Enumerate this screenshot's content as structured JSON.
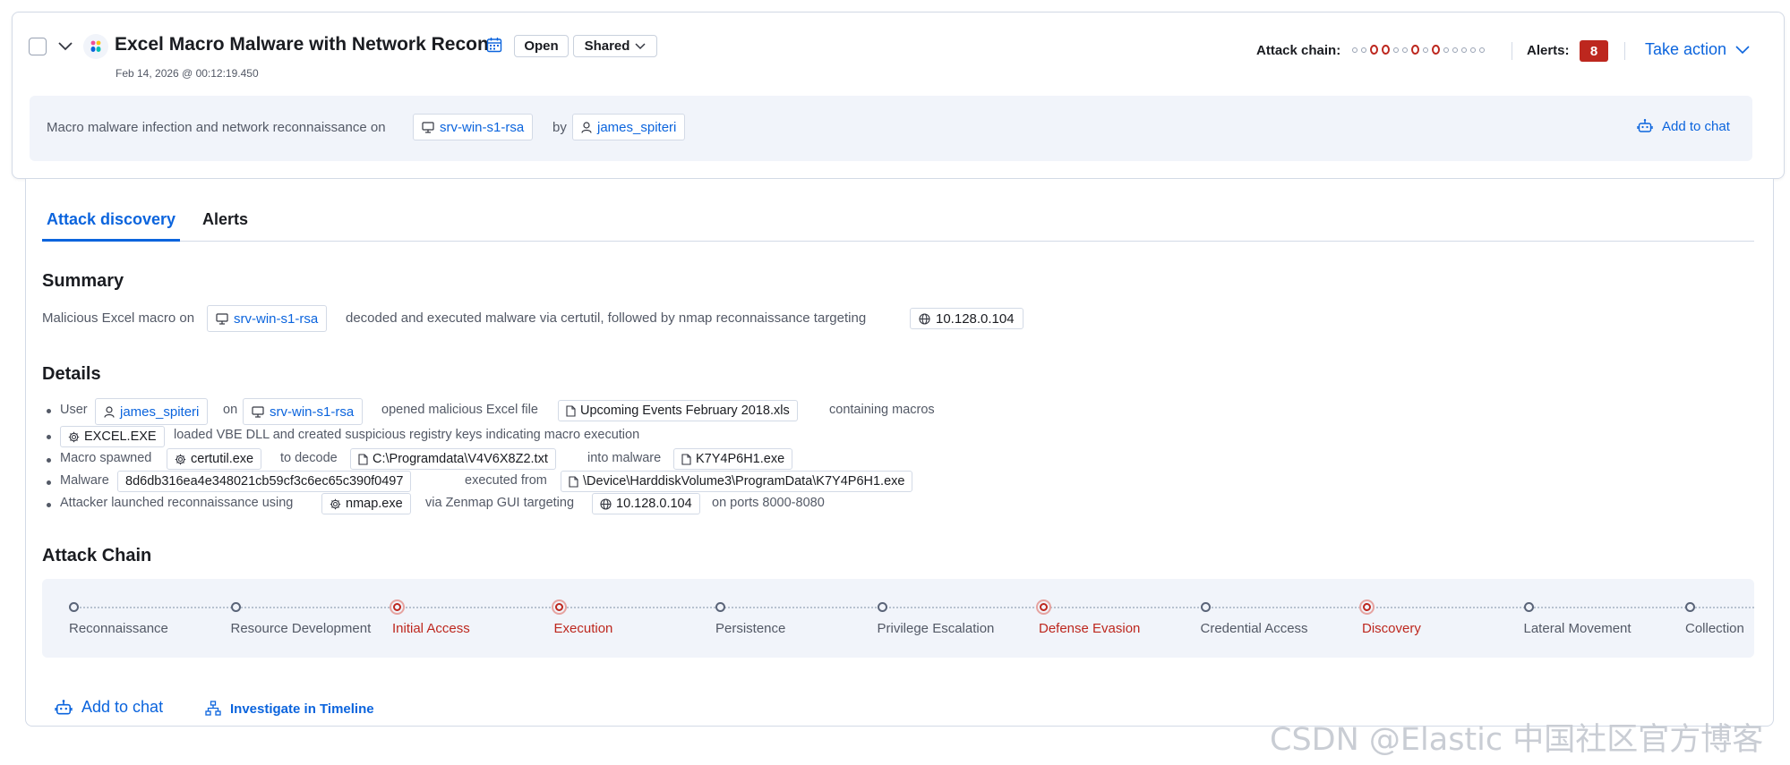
{
  "header": {
    "title": "Excel Macro Malware with Network Recon",
    "timestamp": "Feb 14, 2026 @ 00:12:19.450",
    "open_label": "Open",
    "shared_label": "Shared",
    "attack_chain_label": "Attack chain:",
    "alerts_label": "Alerts:",
    "alerts_count": "8",
    "take_action_label": "Take action"
  },
  "banner": {
    "text_prefix": "Macro malware infection and network reconnaissance on",
    "host": "srv-win-s1-rsa",
    "by": "by",
    "user": "james_spiteri",
    "add_to_chat": "Add to chat"
  },
  "tabs": [
    {
      "label": "Attack discovery",
      "active": true
    },
    {
      "label": "Alerts",
      "active": false
    }
  ],
  "summary": {
    "heading": "Summary",
    "t1": "Malicious Excel macro on",
    "host": "srv-win-s1-rsa",
    "t2": "decoded and executed malware via certutil, followed by nmap reconnaissance targeting",
    "ip": "10.128.0.104"
  },
  "details": {
    "heading": "Details",
    "row1": {
      "t1": "User",
      "user": "james_spiteri",
      "t2": "on",
      "host": "srv-win-s1-rsa",
      "t3": "opened malicious Excel file",
      "file": "Upcoming Events February 2018.xls",
      "t4": "containing macros"
    },
    "row2": {
      "process": "EXCEL.EXE",
      "t1": "loaded VBE DLL and created suspicious registry keys indicating macro execution"
    },
    "row3": {
      "t1": "Macro spawned",
      "process": "certutil.exe",
      "t2": "to decode",
      "file": "C:\\Programdata\\V4V6X8Z2.txt",
      "t3": "into malware",
      "malware": "K7Y4P6H1.exe"
    },
    "row4": {
      "t1": "Malware",
      "hash": "8d6db316ea4e348021cb59cf3c6ec65c390f0497",
      "t2": "executed from",
      "path": "\\Device\\HarddiskVolume3\\ProgramData\\K7Y4P6H1.exe"
    },
    "row5": {
      "t1": "Attacker launched reconnaissance using",
      "process": "nmap.exe",
      "t2": "via Zenmap GUI targeting",
      "ip": "10.128.0.104",
      "t3": "on ports 8000-8080"
    }
  },
  "attack_chain": {
    "heading": "Attack Chain",
    "stages": [
      {
        "label": "Reconnaissance",
        "active": false
      },
      {
        "label": "Resource Development",
        "active": false
      },
      {
        "label": "Initial Access",
        "active": true
      },
      {
        "label": "Execution",
        "active": true
      },
      {
        "label": "Persistence",
        "active": false
      },
      {
        "label": "Privilege Escalation",
        "active": false
      },
      {
        "label": "Defense Evasion",
        "active": true
      },
      {
        "label": "Credential Access",
        "active": false
      },
      {
        "label": "Discovery",
        "active": true
      },
      {
        "label": "Lateral Movement",
        "active": false
      },
      {
        "label": "Collection",
        "active": false
      }
    ],
    "mini_active": [
      false,
      false,
      true,
      true,
      false,
      false,
      true,
      false,
      true,
      false,
      false,
      false,
      false,
      false
    ]
  },
  "footer": {
    "add_to_chat": "Add to chat",
    "investigate": "Investigate in Timeline"
  },
  "watermark": "CSDN @Elastic 中国社区官方博客",
  "colors": {
    "accent": "#0b64dd",
    "danger": "#bd271e",
    "panel": "#f1f4fa"
  }
}
